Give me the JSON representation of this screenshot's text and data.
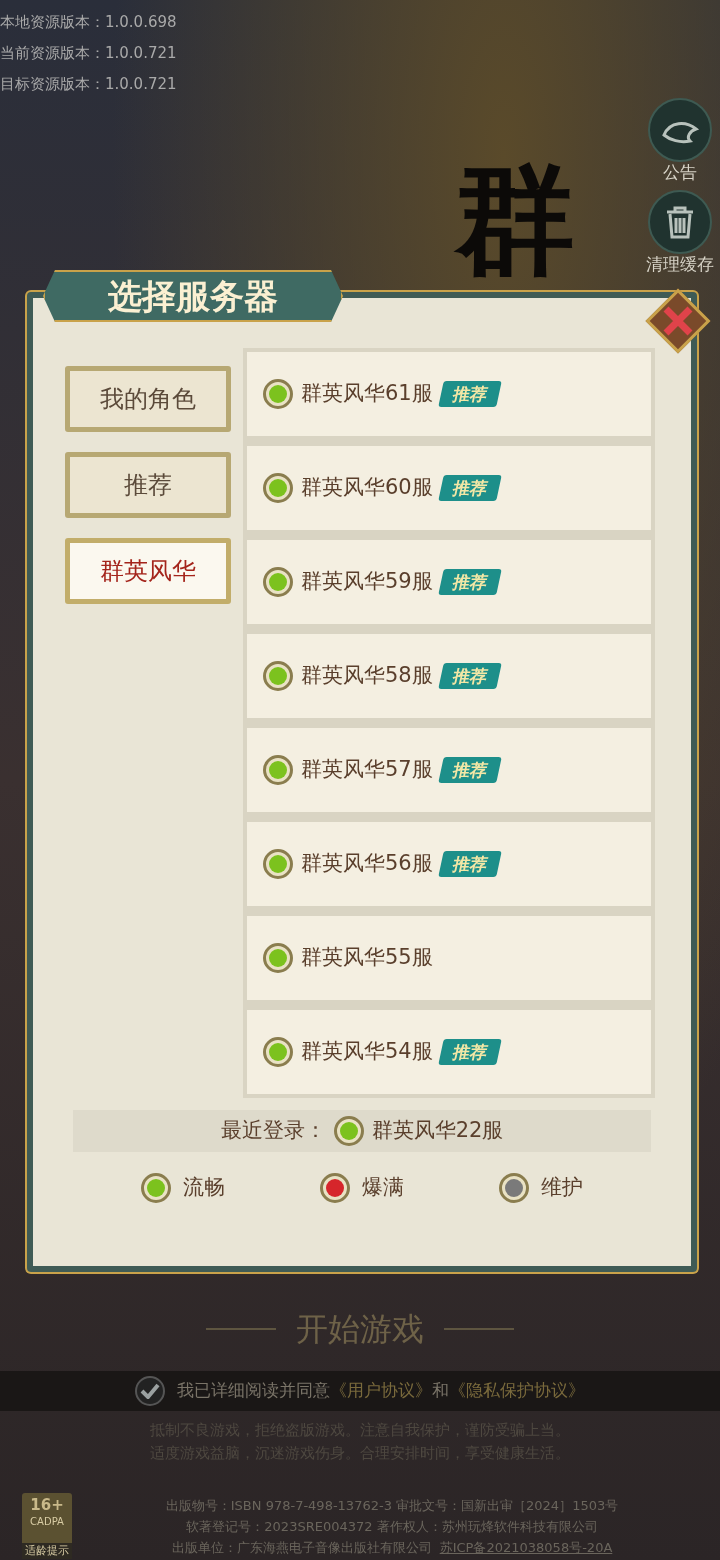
{
  "versions": [
    {
      "label": "本地资源版本：",
      "value": "1.0.0.698"
    },
    {
      "label": "当前资源版本：",
      "value": "1.0.0.721"
    },
    {
      "label": "目标资源版本：",
      "value": "1.0.0.721"
    }
  ],
  "side_buttons": [
    {
      "kind": "notice",
      "label": "公告"
    },
    {
      "kind": "trash",
      "label": "清理缓存"
    }
  ],
  "logo_text": "群",
  "dialog": {
    "title": "选择服务器",
    "tabs": [
      {
        "label": "我的角色",
        "selected": false
      },
      {
        "label": "推荐",
        "selected": false
      },
      {
        "label": "群英风华",
        "selected": true
      }
    ],
    "servers": [
      {
        "name": "群英风华61服",
        "color": "#7cc21e",
        "tag": "推荐"
      },
      {
        "name": "群英风华60服",
        "color": "#7cc21e",
        "tag": "推荐"
      },
      {
        "name": "群英风华59服",
        "color": "#7cc21e",
        "tag": "推荐"
      },
      {
        "name": "群英风华58服",
        "color": "#7cc21e",
        "tag": "推荐"
      },
      {
        "name": "群英风华57服",
        "color": "#7cc21e",
        "tag": "推荐"
      },
      {
        "name": "群英风华56服",
        "color": "#7cc21e",
        "tag": "推荐"
      },
      {
        "name": "群英风华55服",
        "color": "#7cc21e"
      },
      {
        "name": "群英风华54服",
        "color": "#7cc21e",
        "tag": "推荐"
      }
    ],
    "recent": {
      "label": "最近登录：",
      "name": "群英风华22服",
      "color": "#7cc21e"
    },
    "legend": [
      {
        "label": "流畅",
        "color": "#7cc21e"
      },
      {
        "label": "爆满",
        "color": "#d6262b"
      },
      {
        "label": "维护",
        "color": "#7a7a7a"
      }
    ]
  },
  "start_button": "开始游戏",
  "agreement": {
    "checked": true,
    "text": "我已详细阅读并同意",
    "link1": "《用户协议》",
    "joiner": "和",
    "link2": "《隐私保护协议》"
  },
  "notice_lines": [
    "抵制不良游戏，拒绝盗版游戏。注意自我保护，谨防受骗上当。",
    "适度游戏益脑，沉迷游戏伤身。合理安排时间，享受健康生活。"
  ],
  "age_badge": {
    "rating": "16+",
    "org": "CADPA",
    "caption": "适龄提示"
  },
  "publication": {
    "line1": "出版物号：ISBN 978-7-498-13762-3  审批文号：国新出审［2024］1503号",
    "line2": "软著登记号：2023SRE004372  著作权人：苏州玩烽软件科技有限公司",
    "line3": "出版单位：广东海燕电子音像出版社有限公司",
    "icp": "苏ICP备2021038058号-20A"
  }
}
